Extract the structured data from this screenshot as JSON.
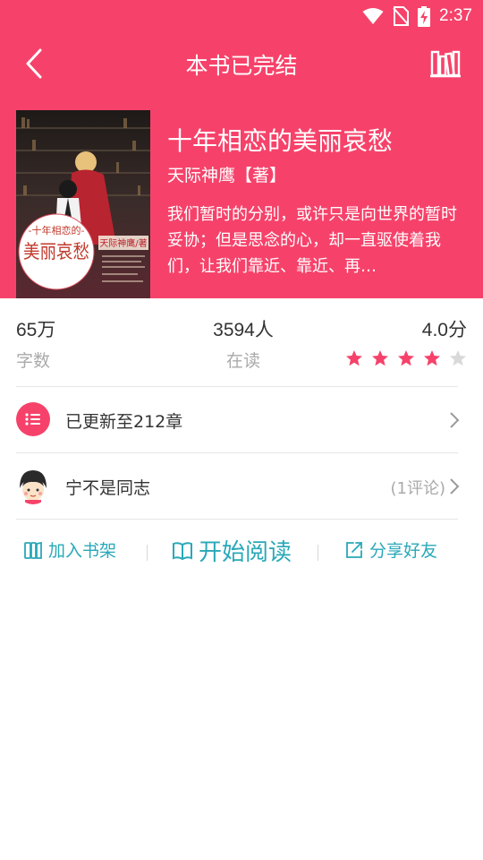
{
  "status_bar": {
    "time": "2:37",
    "icons": [
      "wifi-icon",
      "no-sim-icon",
      "battery-charging-icon"
    ]
  },
  "nav": {
    "title": "本书已完结",
    "back_icon": "back-chevron-icon",
    "shelf_icon": "bookshelf-icon"
  },
  "book": {
    "title": "十年相恋的美丽哀愁",
    "author": "天际神鹰【著】",
    "description": "我们暂时的分别，或许只是向世界的暂时妥协；但是思念的心，却一直驱使着我们，让我们靠近、靠近、再…",
    "cover": {
      "badge_top": "-十年相恋的-",
      "badge_main": "美丽哀愁",
      "author_tag": "天际神鹰/著"
    }
  },
  "stats": {
    "words": {
      "value": "65万",
      "label": "字数"
    },
    "readers": {
      "value": "3594人",
      "label": "在读"
    },
    "rating": {
      "value": "4.0分",
      "stars_filled": 4,
      "stars_total": 5
    }
  },
  "rows": {
    "chapters": {
      "label": "已更新至212章",
      "icon": "list-icon"
    },
    "comment": {
      "user": "宁不是同志",
      "count": "(1评论)",
      "icon": "avatar"
    }
  },
  "actions": {
    "add_shelf": "加入书架",
    "start_read": "开始阅读",
    "share": "分享好友"
  },
  "colors": {
    "brand": "#F6426A",
    "action": "#29A8B8",
    "muted": "#AAAAAA"
  }
}
